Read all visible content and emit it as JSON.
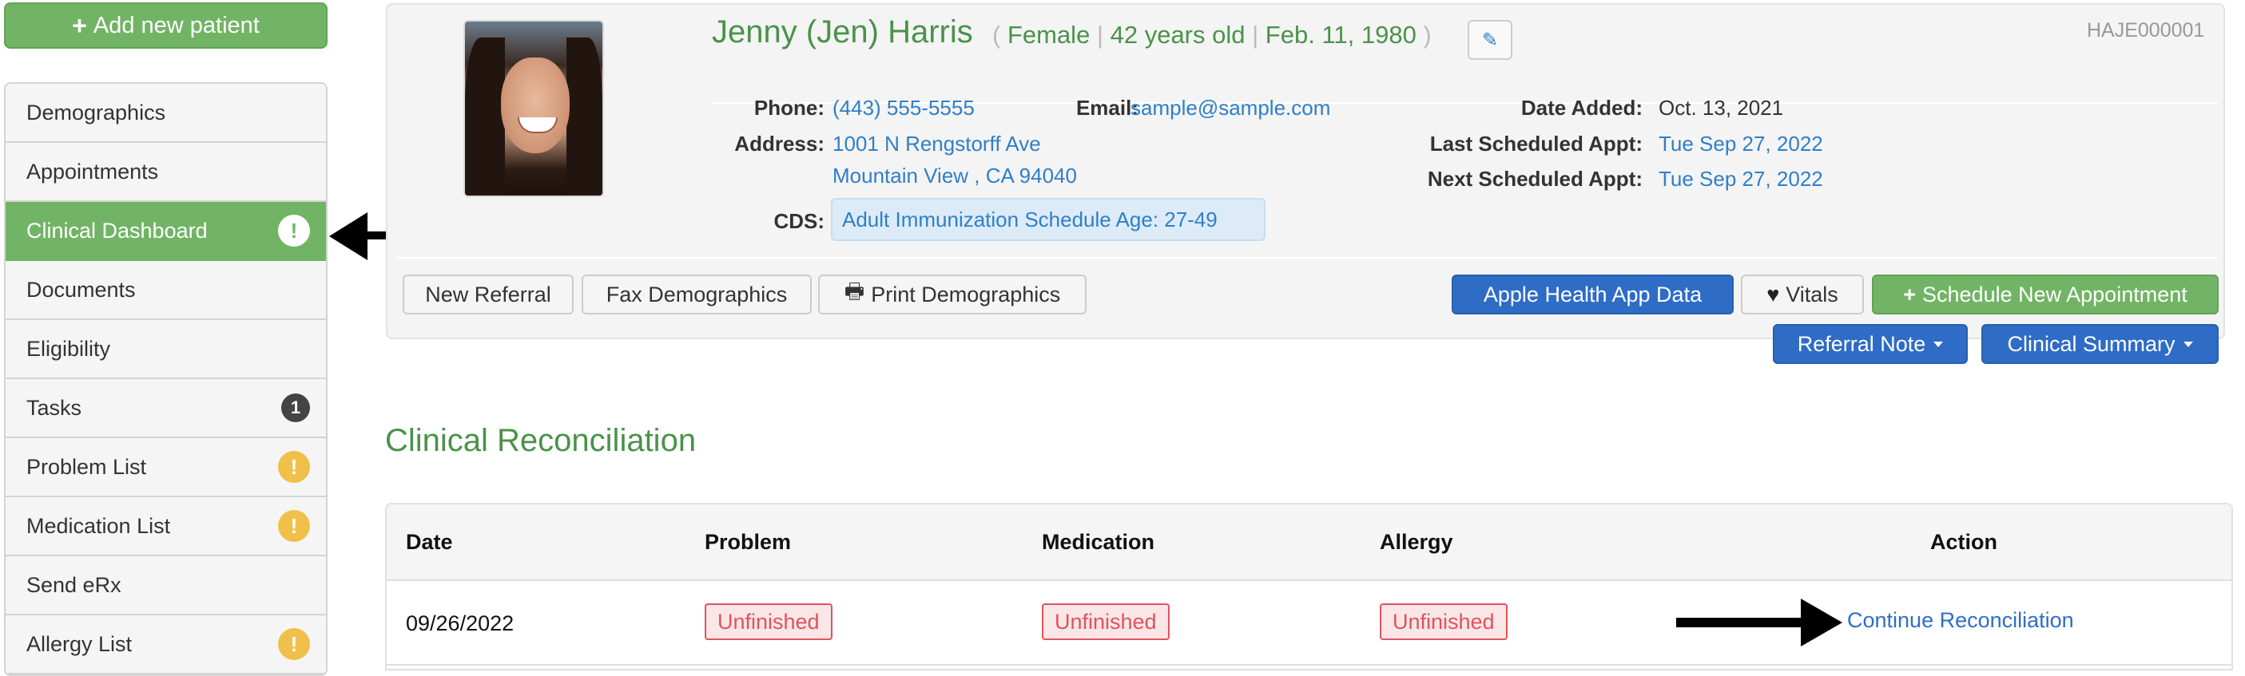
{
  "sidebar": {
    "add_patient_label": "Add new patient",
    "items": [
      {
        "label": "Demographics",
        "badge": null
      },
      {
        "label": "Appointments",
        "badge": null
      },
      {
        "label": "Clinical Dashboard",
        "badge": "!",
        "active": true
      },
      {
        "label": "Documents",
        "badge": null
      },
      {
        "label": "Eligibility",
        "badge": null
      },
      {
        "label": "Tasks",
        "badge": "1"
      },
      {
        "label": "Problem List",
        "badge": "!"
      },
      {
        "label": "Medication List",
        "badge": "!"
      },
      {
        "label": "Send eRx",
        "badge": null
      },
      {
        "label": "Allergy List",
        "badge": "!"
      }
    ]
  },
  "patient": {
    "name": "Jenny (Jen) Harris",
    "gender": "Female",
    "age": "42 years old",
    "dob": "Feb. 11, 1980",
    "id": "HAJE000001",
    "phone_label": "Phone:",
    "phone": "(443) 555-5555",
    "email_label": "Email:",
    "email": "sample@sample.com",
    "address_label": "Address:",
    "address_line1": "1001 N Rengstorff Ave",
    "address_line2": "Mountain View , CA 94040",
    "cds_label": "CDS:",
    "cds": "Adult Immunization Schedule Age: 27-49",
    "date_added_label": "Date Added:",
    "date_added": "Oct. 13, 2021",
    "last_appt_label": "Last Scheduled Appt:",
    "last_appt": "Tue Sep 27, 2022",
    "next_appt_label": "Next Scheduled Appt:",
    "next_appt": "Tue Sep 27, 2022"
  },
  "actions": {
    "new_referral": "New Referral",
    "fax_demographics": "Fax Demographics",
    "print_demographics": "Print Demographics",
    "apple_health": "Apple Health App Data",
    "vitals": "Vitals",
    "schedule_appt": "Schedule New Appointment",
    "referral_note": "Referral Note",
    "clinical_summary": "Clinical Summary"
  },
  "reconciliation": {
    "title": "Clinical Reconciliation",
    "columns": [
      "Date",
      "Problem",
      "Medication",
      "Allergy",
      "Action"
    ],
    "rows": [
      {
        "date": "09/26/2022",
        "problem": "Unfinished",
        "medication": "Unfinished",
        "allergy": "Unfinished",
        "action": "Continue Reconciliation"
      }
    ]
  },
  "colors": {
    "brand_green": "#72b465",
    "title_green": "#4a9249",
    "link_blue": "#2f7fc8",
    "primary_blue": "#2e6cc6",
    "warning": "#f0c04a",
    "danger": "#e0535b"
  }
}
